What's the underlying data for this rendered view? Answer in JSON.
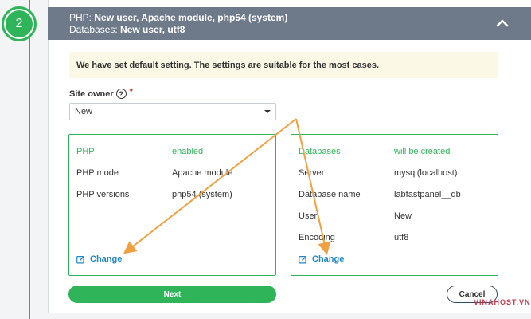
{
  "step": {
    "number": "2"
  },
  "header": {
    "php_label": "PHP:",
    "php_value": "New user, Apache module, php54 (system)",
    "db_label": "Databases:",
    "db_value": "New user, utf8",
    "collapse_icon": "chevron-up-icon"
  },
  "notice": "We have set default setting. The settings are suitable for the most cases.",
  "site_owner": {
    "label": "Site owner",
    "help_glyph": "?",
    "required_mark": "*",
    "selected": "New"
  },
  "php_box": {
    "rows": [
      {
        "key": "PHP",
        "value": "enabled"
      },
      {
        "key": "PHP mode",
        "value": "Apache module"
      },
      {
        "key": "PHP versions",
        "value": "php54 (system)"
      }
    ],
    "change_label": "Change"
  },
  "db_box": {
    "rows": [
      {
        "key": "Databases",
        "value": "will be created"
      },
      {
        "key": "Server",
        "value": "mysql(localhost)"
      },
      {
        "key": "Database name",
        "value": "labfastpanel__db"
      },
      {
        "key": "User",
        "value": "New"
      },
      {
        "key": "Encoding",
        "value": "utf8"
      }
    ],
    "change_label": "Change"
  },
  "buttons": {
    "next": "Next",
    "cancel": "Cancel"
  },
  "watermark": "VINAHOST.VN",
  "colors": {
    "accent": "#30b45a",
    "header": "#6e7a8a",
    "link": "#1e88c7",
    "arrow": "#f0a040"
  }
}
